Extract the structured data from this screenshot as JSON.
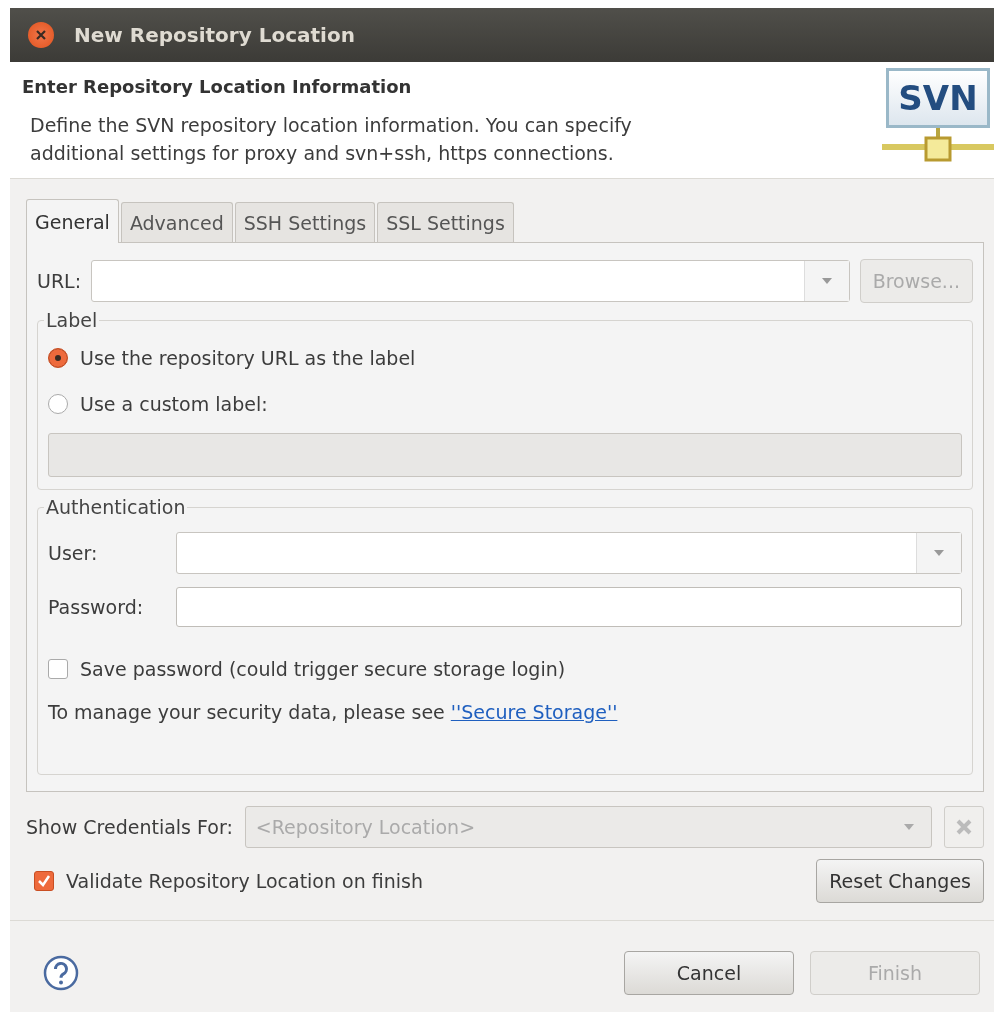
{
  "window": {
    "title": "New Repository Location"
  },
  "header": {
    "title": "Enter Repository Location Information",
    "description": "Define the SVN repository location information. You can specify additional settings for proxy and svn+ssh, https connections.",
    "logo_text": "SVN"
  },
  "tabs": [
    {
      "label": "General",
      "selected": true
    },
    {
      "label": "Advanced",
      "selected": false
    },
    {
      "label": "SSH Settings",
      "selected": false
    },
    {
      "label": "SSL Settings",
      "selected": false
    }
  ],
  "url": {
    "label": "URL:",
    "browse": "Browse...",
    "browse_disabled": true
  },
  "label_group": {
    "title": "Label",
    "custom_field_disabled": true,
    "options": [
      {
        "label": "Use the repository URL as the label",
        "selected": true
      },
      {
        "label": "Use a custom label:",
        "selected": false
      }
    ]
  },
  "authentication": {
    "title": "Authentication",
    "user_label": "User:",
    "password_label": "Password:",
    "save_password": {
      "label": "Save password (could trigger secure storage login)",
      "checked": false
    },
    "note": "To manage your security data, please see",
    "link": "''Secure Storage''"
  },
  "credentials": {
    "label": "Show Credentials For:",
    "value": "<Repository Location>",
    "disabled": true
  },
  "validate": {
    "label": "Validate Repository Location on finish",
    "checked": true
  },
  "reset_button": "Reset Changes",
  "buttons": [
    {
      "label": "Cancel",
      "disabled": false
    },
    {
      "label": "Finish",
      "disabled": true
    }
  ]
}
